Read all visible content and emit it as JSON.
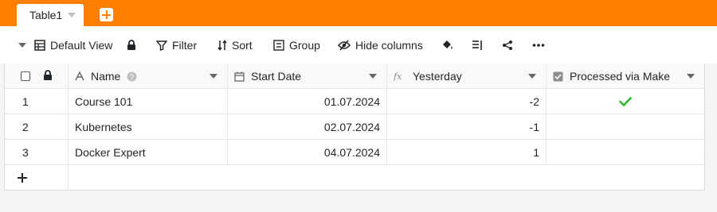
{
  "tabs": [
    {
      "label": "Table1"
    }
  ],
  "toolbar": {
    "view_label": "Default View",
    "filter_label": "Filter",
    "sort_label": "Sort",
    "group_label": "Group",
    "hide_columns_label": "Hide columns"
  },
  "columns": {
    "name": "Name",
    "start_date": "Start Date",
    "yesterday": "Yesterday",
    "processed": "Processed via Make"
  },
  "rows": [
    {
      "index": "1",
      "name": "Course 101",
      "start_date": "01.07.2024",
      "yesterday": "-2",
      "processed": true
    },
    {
      "index": "2",
      "name": "Kubernetes",
      "start_date": "02.07.2024",
      "yesterday": "-1",
      "processed": false
    },
    {
      "index": "3",
      "name": "Docker Expert",
      "start_date": "04.07.2024",
      "yesterday": "1",
      "processed": false
    }
  ],
  "colors": {
    "accent": "#ff8000",
    "check": "#2eb82e"
  }
}
